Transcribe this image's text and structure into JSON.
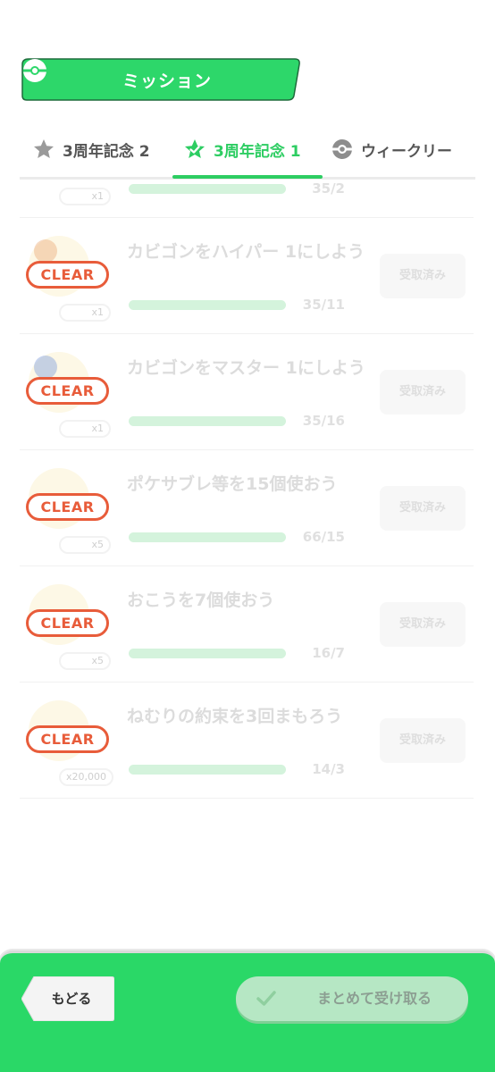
{
  "header": {
    "title": "ミッション",
    "icon": "pokeball-icon",
    "color": "#2dd76a"
  },
  "tabs": [
    {
      "label": "3周年記念 2",
      "icon": "star-icon",
      "active": false
    },
    {
      "label": "3周年記念 1",
      "icon": "star-check-icon",
      "active": true
    },
    {
      "label": "ウィークリー",
      "icon": "pokeball-icon",
      "active": false
    }
  ],
  "partial_row": {
    "qty": "x1",
    "count": "35/2"
  },
  "missions": [
    {
      "title": "カビゴンをハイパー 1にしよう",
      "qty": "x1",
      "count": "35/11",
      "status": "CLEAR",
      "button": "受取済み",
      "thumb_color": "#e8a066"
    },
    {
      "title": "カビゴンをマスター 1にしよう",
      "qty": "x1",
      "count": "35/16",
      "status": "CLEAR",
      "button": "受取済み",
      "thumb_color": "#6a8fd8"
    },
    {
      "title": "ポケサブレ等を15個使おう",
      "qty": "x5",
      "count": "66/15",
      "status": "CLEAR",
      "button": "受取済み",
      "thumb_color": "#f0d58a"
    },
    {
      "title": "おこうを7個使おう",
      "qty": "x5",
      "count": "16/7",
      "status": "CLEAR",
      "button": "受取済み",
      "thumb_color": "#f0d58a"
    },
    {
      "title": "ねむりの約束を3回まもろう",
      "qty": "x20,000",
      "count": "14/3",
      "status": "CLEAR",
      "button": "受取済み",
      "thumb_color": "#f3e7a0"
    }
  ],
  "footer": {
    "back_label": "もどる",
    "claim_all_label": "まとめて受け取る"
  },
  "colors": {
    "accent": "#2dcd62",
    "clear": "#e85c3a",
    "footer_bg": "#2ad867"
  }
}
